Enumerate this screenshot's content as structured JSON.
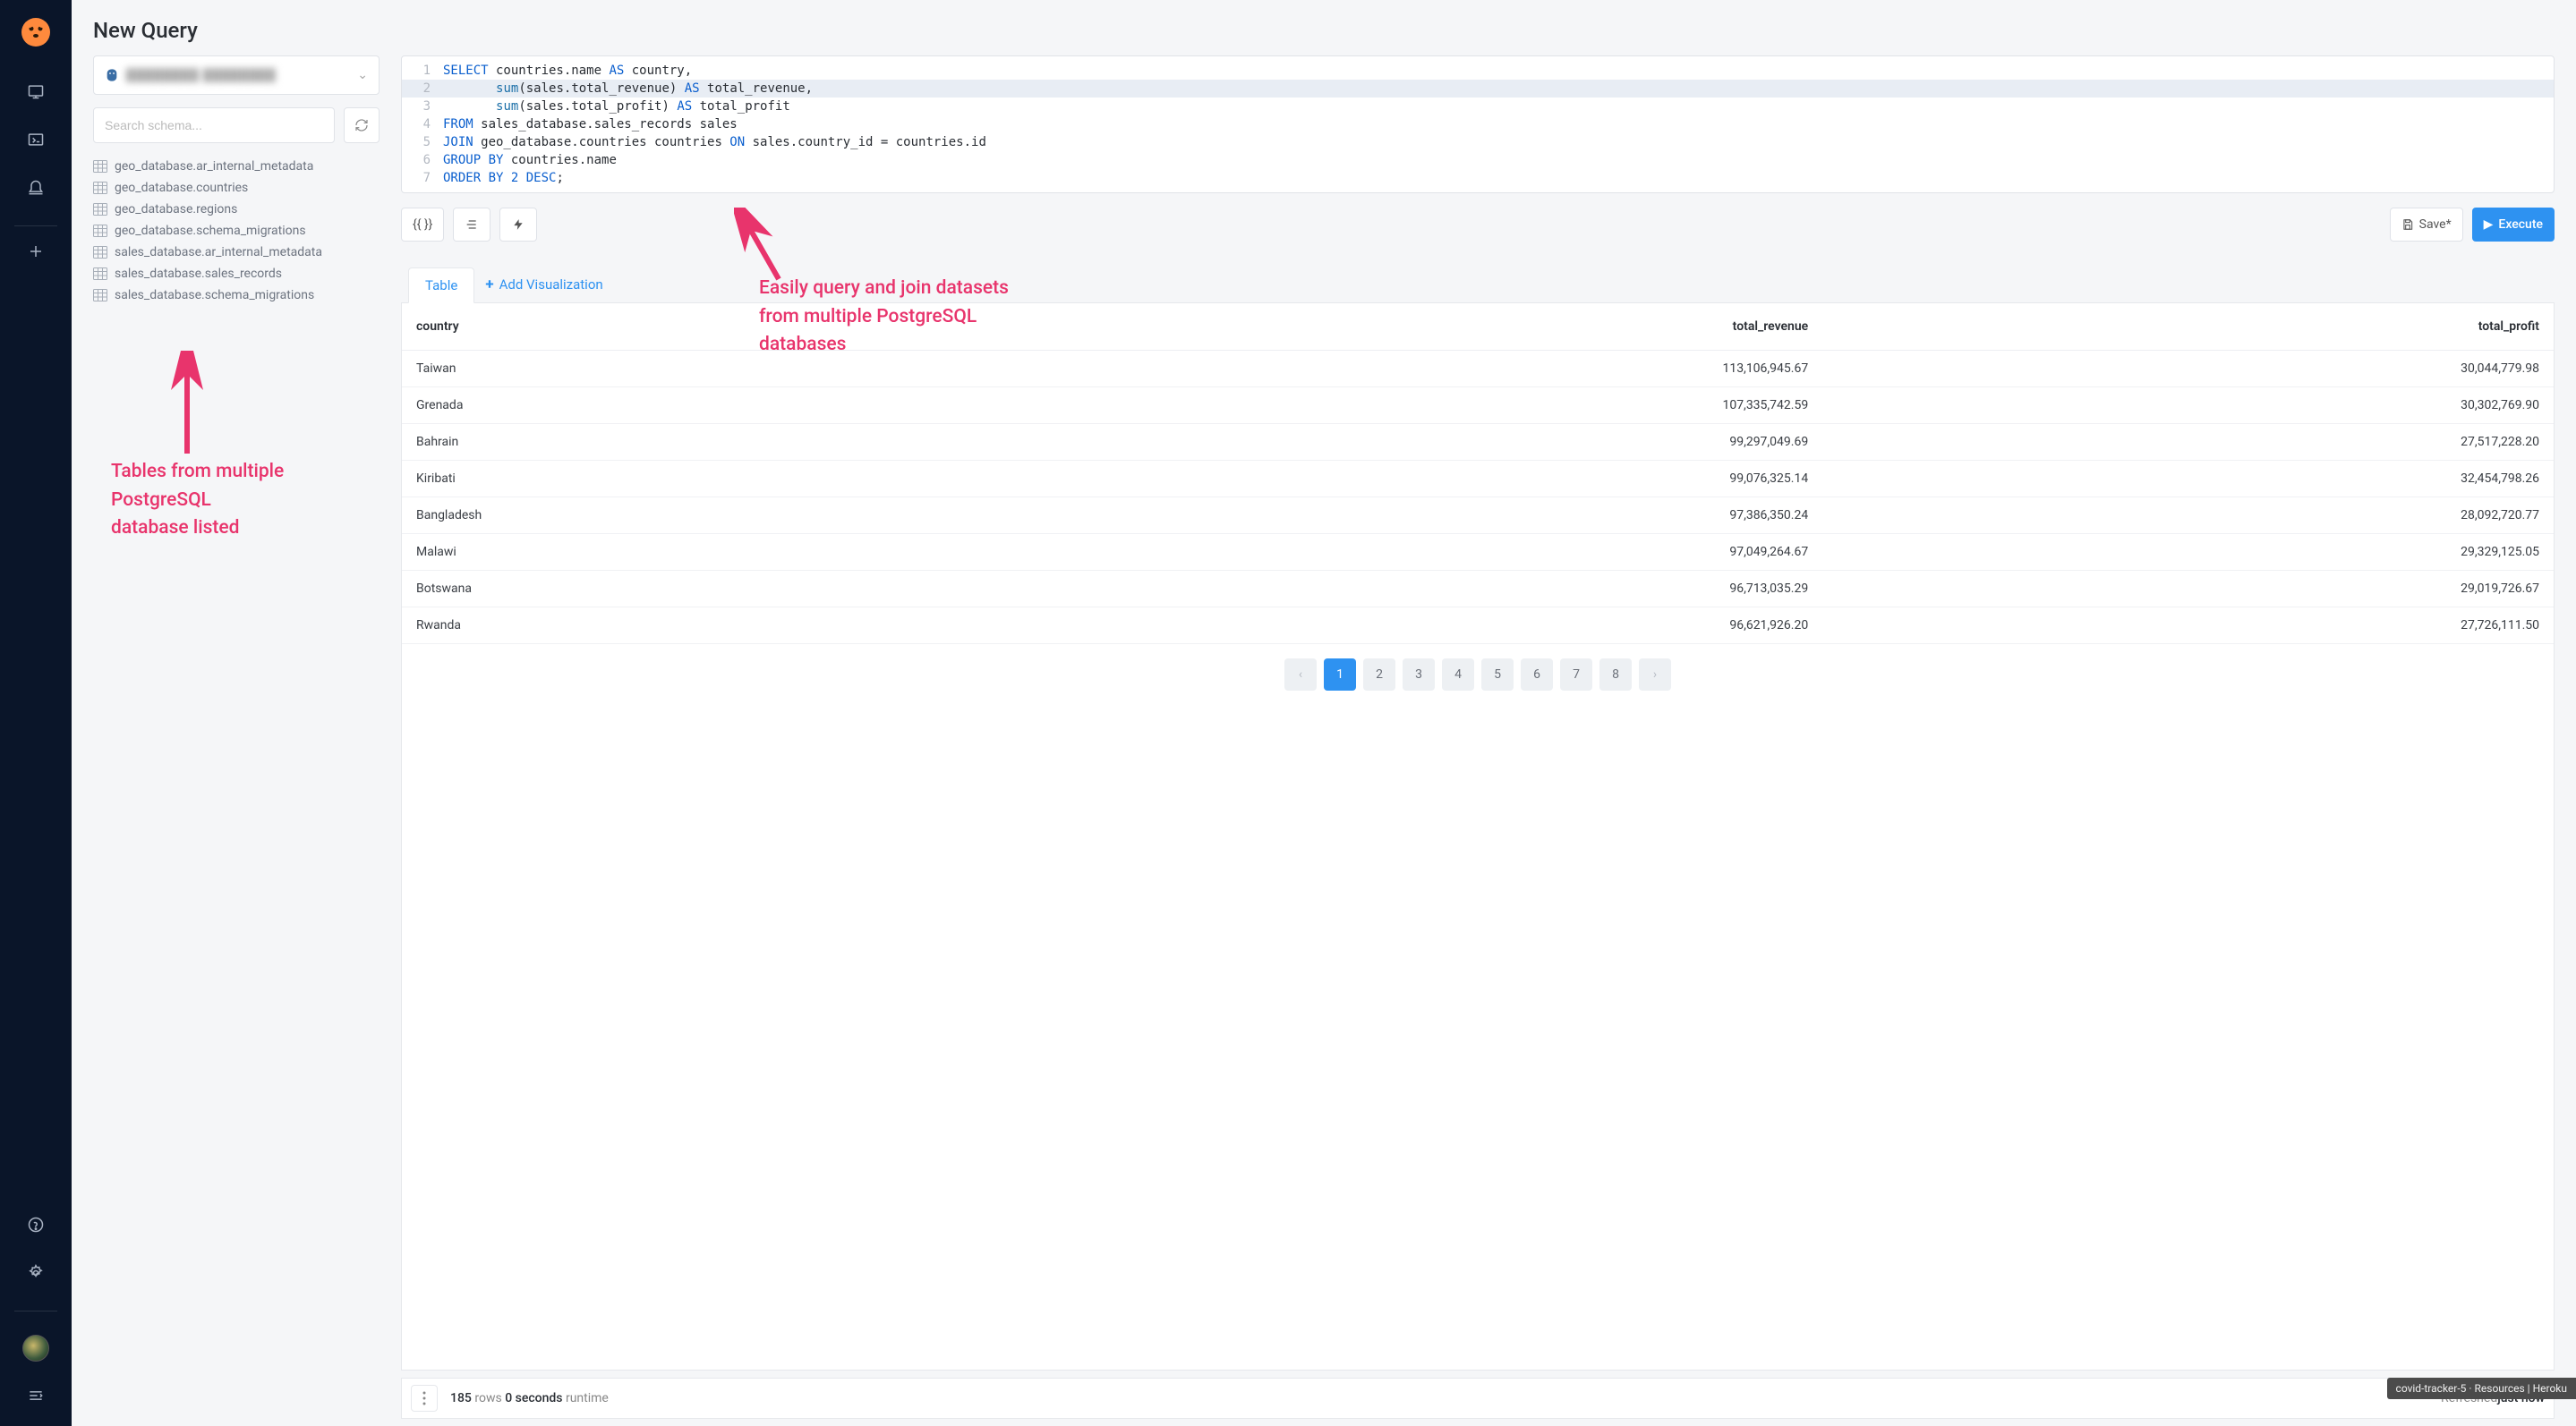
{
  "page_title": "New Query",
  "datasource": {
    "blurred_text": "████████ ████████"
  },
  "search": {
    "placeholder": "Search schema..."
  },
  "schema_tables": [
    "geo_database.ar_internal_metadata",
    "geo_database.countries",
    "geo_database.regions",
    "geo_database.schema_migrations",
    "sales_database.ar_internal_metadata",
    "sales_database.sales_records",
    "sales_database.schema_migrations"
  ],
  "annotations": {
    "left": "Tables from multiple\nPostgreSQL\ndatabase listed",
    "main": "Easily query and join datasets\nfrom multiple PostgreSQL\ndatabases"
  },
  "editor": {
    "lines": [
      {
        "n": "1",
        "segs": [
          [
            "kw",
            "SELECT"
          ],
          [
            "tx",
            " countries.name "
          ],
          [
            "kw",
            "AS"
          ],
          [
            "tx",
            " country,"
          ]
        ]
      },
      {
        "n": "2",
        "hl": true,
        "segs": [
          [
            "tx",
            "       "
          ],
          [
            "fn",
            "sum"
          ],
          [
            "tx",
            "(sales.total_revenue) "
          ],
          [
            "kw",
            "AS"
          ],
          [
            "tx",
            " total_revenue,"
          ]
        ]
      },
      {
        "n": "3",
        "segs": [
          [
            "tx",
            "       "
          ],
          [
            "fn",
            "sum"
          ],
          [
            "tx",
            "(sales.total_profit) "
          ],
          [
            "kw",
            "AS"
          ],
          [
            "tx",
            " total_profit"
          ]
        ]
      },
      {
        "n": "4",
        "segs": [
          [
            "kw",
            "FROM"
          ],
          [
            "tx",
            " sales_database.sales_records sales"
          ]
        ]
      },
      {
        "n": "5",
        "segs": [
          [
            "kw",
            "JOIN"
          ],
          [
            "tx",
            " geo_database.countries countries "
          ],
          [
            "kw",
            "ON"
          ],
          [
            "tx",
            " sales.country_id = countries.id"
          ]
        ]
      },
      {
        "n": "6",
        "segs": [
          [
            "kw",
            "GROUP BY"
          ],
          [
            "tx",
            " countries.name"
          ]
        ]
      },
      {
        "n": "7",
        "segs": [
          [
            "kw",
            "ORDER BY"
          ],
          [
            "tx",
            " "
          ],
          [
            "kw",
            "2 DESC"
          ],
          [
            "tx",
            ";"
          ]
        ]
      }
    ]
  },
  "toolbar": {
    "braces": "{{ }}",
    "save": "Save*",
    "execute": "Execute"
  },
  "tabs": {
    "table": "Table",
    "add_viz": "Add Visualization"
  },
  "results": {
    "columns": [
      "country",
      "total_revenue",
      "total_profit"
    ],
    "rows": [
      [
        "Taiwan",
        "113,106,945.67",
        "30,044,779.98"
      ],
      [
        "Grenada",
        "107,335,742.59",
        "30,302,769.90"
      ],
      [
        "Bahrain",
        "99,297,049.69",
        "27,517,228.20"
      ],
      [
        "Kiribati",
        "99,076,325.14",
        "32,454,798.26"
      ],
      [
        "Bangladesh",
        "97,386,350.24",
        "28,092,720.77"
      ],
      [
        "Malawi",
        "97,049,264.67",
        "29,329,125.05"
      ],
      [
        "Botswana",
        "96,713,035.29",
        "29,019,726.67"
      ],
      [
        "Rwanda",
        "96,621,926.20",
        "27,726,111.50"
      ]
    ]
  },
  "pagination": {
    "pages": [
      "1",
      "2",
      "3",
      "4",
      "5",
      "6",
      "7",
      "8"
    ],
    "active": "1"
  },
  "status": {
    "rows": "185",
    "rows_label": "rows",
    "seconds": "0 seconds",
    "seconds_label": "runtime",
    "refreshed": "Refreshed ",
    "refreshed_time": "just now"
  },
  "heroku_badge": "covid-tracker-5 · Resources | Heroku"
}
